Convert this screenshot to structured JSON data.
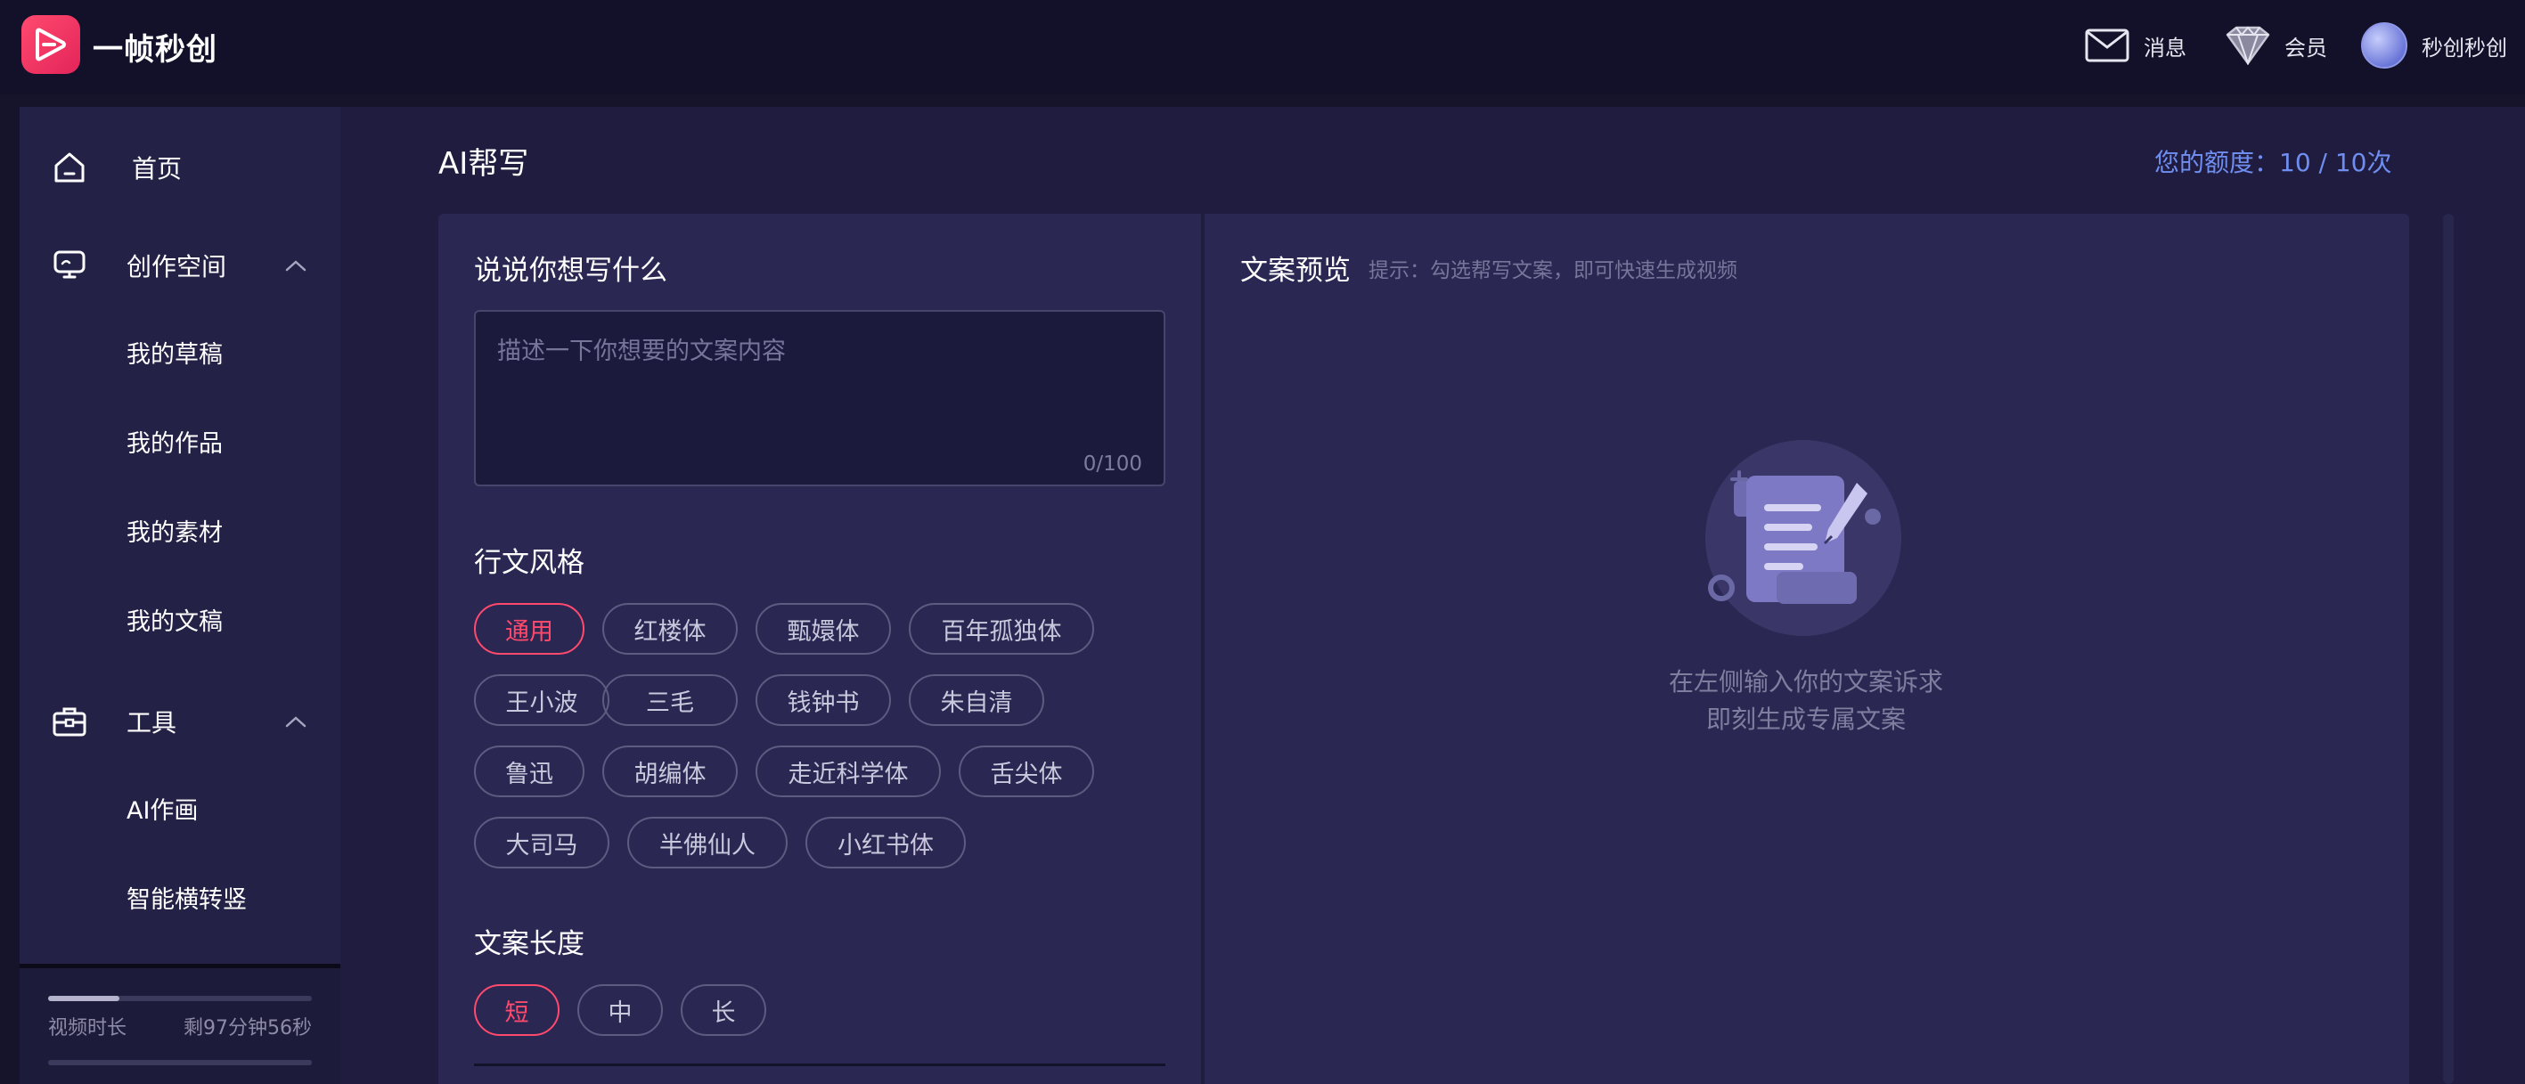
{
  "app": {
    "brand": "一帧秒创"
  },
  "header": {
    "messages": "消息",
    "vip": "会员",
    "user": "秒创秒创"
  },
  "sidebar": {
    "home": "首页",
    "workspace": {
      "label": "创作空间",
      "items": [
        "我的草稿",
        "我的作品",
        "我的素材",
        "我的文稿"
      ]
    },
    "tools": {
      "label": "工具",
      "items": [
        "AI作画",
        "智能横转竖"
      ]
    },
    "quota": {
      "video_label": "视频时长",
      "video_value": "剩97分钟56秒",
      "video_used_fraction": 0.27,
      "second_used_fraction": 1.0
    }
  },
  "page": {
    "title": "AI帮写",
    "credits": "您的额度：10 / 10次"
  },
  "write": {
    "section_title": "说说你想写什么",
    "placeholder": "描述一下你想要的文案内容",
    "counter": "0/100"
  },
  "style": {
    "section_title": "行文风格",
    "options": [
      "通用",
      "红楼体",
      "甄嬛体",
      "百年孤独体",
      "王小波",
      "三毛",
      "钱钟书",
      "朱自清",
      "鲁迅",
      "胡编体",
      "走近科学体",
      "舌尖体",
      "大司马",
      "半佛仙人",
      "小红书体"
    ],
    "selected": "通用"
  },
  "length": {
    "section_title": "文案长度",
    "options": [
      "短",
      "中",
      "长"
    ],
    "selected": "短"
  },
  "preview": {
    "title": "文案预览",
    "hint": "提示：勾选帮写文案，即可快速生成视频",
    "empty_line1": "在左侧输入你的文案诉求",
    "empty_line2": "即刻生成专属文案"
  },
  "colors": {
    "accent": "#ff4a6e",
    "link": "#6f8ef0",
    "panel": "#2a2752",
    "sidebar": "#232145"
  }
}
